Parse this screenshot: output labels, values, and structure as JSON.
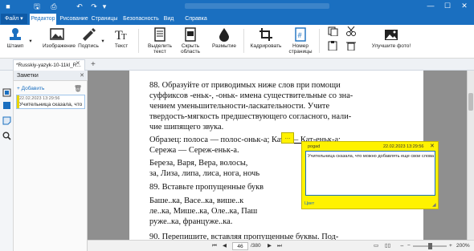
{
  "titlebar": {
    "icons": [
      "save-icon",
      "print-icon",
      "undo-icon",
      "redo-icon",
      "dropdown-icon"
    ],
    "controls": [
      "minimize-icon",
      "maximize-icon",
      "close-icon"
    ]
  },
  "menu": {
    "file": "Файл",
    "tabs": [
      "Редактор",
      "Рисование",
      "Страницы",
      "Безопасность",
      "Вид",
      "Справка"
    ]
  },
  "ribbon": {
    "stamp": "Штамп",
    "image": "Изображение",
    "signature": "Подпись",
    "text": "Текст",
    "select_text_1": "Выделить",
    "select_text_2": "текст",
    "hide_area_1": "Скрыть",
    "hide_area_2": "область",
    "blur": "Размытие",
    "crop": "Кадрировать",
    "page_number_1": "Номер",
    "page_number_2": "страницы",
    "enhance_photo": "Улучшите фото!"
  },
  "doctab": {
    "name": "*Russkiy-yazyk-10-11kl_R..."
  },
  "notes": {
    "title": "Заметки",
    "add": "+ Добавить",
    "item": {
      "date": "22.02.2023 13:29:56",
      "text": "Учительница сказала, что мс"
    }
  },
  "page": {
    "lines": [
      "88. Образуйте от приводимых ниже слов при помощи",
      "суффиксов -еньк-, -оньк- имена существительные со зна-",
      "чением  уменьшительности-ласкательности.  Учите",
      "твердость-мягкость предшествующего согласного, нали-",
      "чие шипящего звука.",
      "Образец: полоса — полос-оньк-а; Катя — Кат-еньк-а;",
      "Сережа — Сереж-еньк-а.",
      "Береза, Варя, Вера, волосы,",
      "за, Лиза, липа, лиса, нога, ночь",
      "89. Вставьте пропущенные букв",
      "Баше..ка, Васе..ка, више..к",
      "ле..ка, Мише..ка, Оле..ка, Паш",
      "руже..ка, француже..ка.",
      "90. Перепишите, вставляя пропущенные буквы. Под-"
    ]
  },
  "popup": {
    "author": "pogad",
    "date": "22.02.2023 13:29:56",
    "text": "Учительница сказала, что можно добавлять еще свои слова",
    "color_link": "Цвет",
    "sticky_glyph": "…"
  },
  "status": {
    "current_page": "46",
    "total_pages": "/380",
    "zoom": "200%"
  }
}
